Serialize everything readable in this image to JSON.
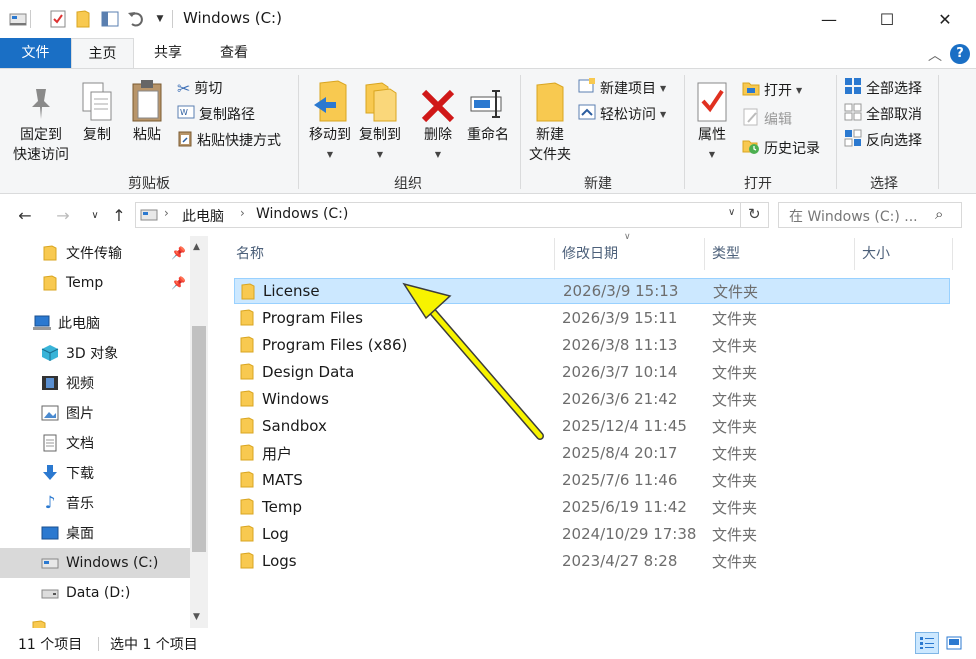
{
  "window": {
    "title": "Windows (C:)",
    "minimize_glyph": "—",
    "maximize_glyph": "☐",
    "close_glyph": "✕"
  },
  "ribbon_tabs": {
    "file": "文件",
    "home": "主页",
    "share": "共享",
    "view": "查看"
  },
  "ribbon": {
    "clipboard": {
      "label": "剪贴板",
      "pin_line1": "固定到",
      "pin_line2": "快速访问",
      "copy": "复制",
      "paste": "粘贴",
      "cut": "剪切",
      "copy_path": "复制路径",
      "paste_shortcut": "粘贴快捷方式"
    },
    "organize": {
      "label": "组织",
      "move_to": "移动到",
      "copy_to": "复制到",
      "delete": "删除",
      "rename": "重命名"
    },
    "new": {
      "label": "新建",
      "new_folder_line1": "新建",
      "new_folder_line2": "文件夹",
      "new_item": "新建项目",
      "easy_access": "轻松访问"
    },
    "open": {
      "label": "打开",
      "properties": "属性",
      "open": "打开",
      "edit": "编辑",
      "history": "历史记录"
    },
    "select": {
      "label": "选择",
      "select_all": "全部选择",
      "select_none": "全部取消",
      "invert": "反向选择"
    }
  },
  "address": {
    "crumbs": [
      "此电脑",
      "Windows (C:)"
    ],
    "search_placeholder": "在 Windows (C:) ..."
  },
  "nav_pane": {
    "items": [
      {
        "label": "文件传输",
        "icon": "folder-icon",
        "pinned": true
      },
      {
        "label": "Temp",
        "icon": "folder-icon",
        "pinned": true
      },
      {
        "label": "此电脑",
        "icon": "computer-icon",
        "pinned": false
      },
      {
        "label": "3D 对象",
        "icon": "cube-icon",
        "pinned": false
      },
      {
        "label": "视频",
        "icon": "video-icon",
        "pinned": false
      },
      {
        "label": "图片",
        "icon": "picture-icon",
        "pinned": false
      },
      {
        "label": "文档",
        "icon": "document-icon",
        "pinned": false
      },
      {
        "label": "下载",
        "icon": "download-icon",
        "pinned": false
      },
      {
        "label": "音乐",
        "icon": "music-icon",
        "pinned": false
      },
      {
        "label": "桌面",
        "icon": "desktop-icon",
        "pinned": false
      },
      {
        "label": "Windows (C:)",
        "icon": "drive-c-icon",
        "pinned": false,
        "selected": true
      },
      {
        "label": "Data (D:)",
        "icon": "drive-d-icon",
        "pinned": false
      }
    ]
  },
  "file_list": {
    "columns": {
      "name": "名称",
      "modified": "修改日期",
      "type": "类型",
      "size": "大小"
    },
    "rows": [
      {
        "name": "License",
        "modified": "2026/3/9 15:13",
        "type": "文件夹",
        "selected": true
      },
      {
        "name": "Program Files",
        "modified": "2026/3/9 15:11",
        "type": "文件夹"
      },
      {
        "name": "Program Files (x86)",
        "modified": "2026/3/8 11:13",
        "type": "文件夹"
      },
      {
        "name": "Design Data",
        "modified": "2026/3/7 10:14",
        "type": "文件夹"
      },
      {
        "name": "Windows",
        "modified": "2026/3/6 21:42",
        "type": "文件夹"
      },
      {
        "name": "Sandbox",
        "modified": "2025/12/4 11:45",
        "type": "文件夹"
      },
      {
        "name": "用户",
        "modified": "2025/8/4 20:17",
        "type": "文件夹"
      },
      {
        "name": "MATS",
        "modified": "2025/7/6 11:46",
        "type": "文件夹"
      },
      {
        "name": "Temp",
        "modified": "2025/6/19 11:42",
        "type": "文件夹"
      },
      {
        "name": "Log",
        "modified": "2024/10/29 17:38",
        "type": "文件夹"
      },
      {
        "name": "Logs",
        "modified": "2023/4/27 8:28",
        "type": "文件夹"
      }
    ]
  },
  "status": {
    "item_count": "11 个项目",
    "selected_count": "选中 1 个项目"
  },
  "colors": {
    "accent": "#1a6fc5",
    "selection": "#cce8ff",
    "folder": "#f8c950",
    "annotation_arrow": "#f7f300"
  }
}
